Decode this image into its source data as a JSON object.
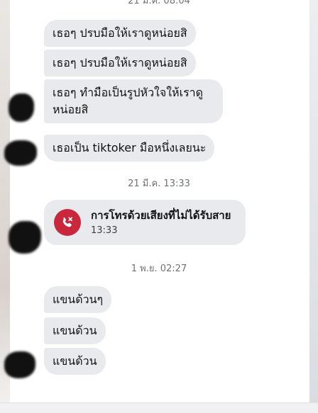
{
  "timestamps": [
    {
      "text": "21 มี.ค. 08:04"
    },
    {
      "text": "21 มี.ค. 13:33"
    },
    {
      "text": "1 พ.ย. 02:27"
    }
  ],
  "messages_group1": [
    "เธอๆ ปรบมือให้เราดูหน่อยสิ",
    "เธอๆ ปรบมือให้เราดูหน่อยสิ",
    "เธอๆ ทำมือเป็นรูปหัวใจให้เราดูหน่อยสิ",
    "เธอเป็น tiktoker มือหนึ่งเลยนะ"
  ],
  "missed_call": {
    "title": "การโทรด้วยเสียงที่ไม่ได้รับสาย",
    "time": "13:33",
    "icon": "missed-call-phone-icon",
    "color": "#c9273c"
  },
  "messages_group2": [
    "แขนด้วนๆ",
    "แขนด้วน",
    "แขนด้วน"
  ],
  "colors": {
    "bubble": "#e9eaee",
    "timestamp": "#6f7277"
  }
}
